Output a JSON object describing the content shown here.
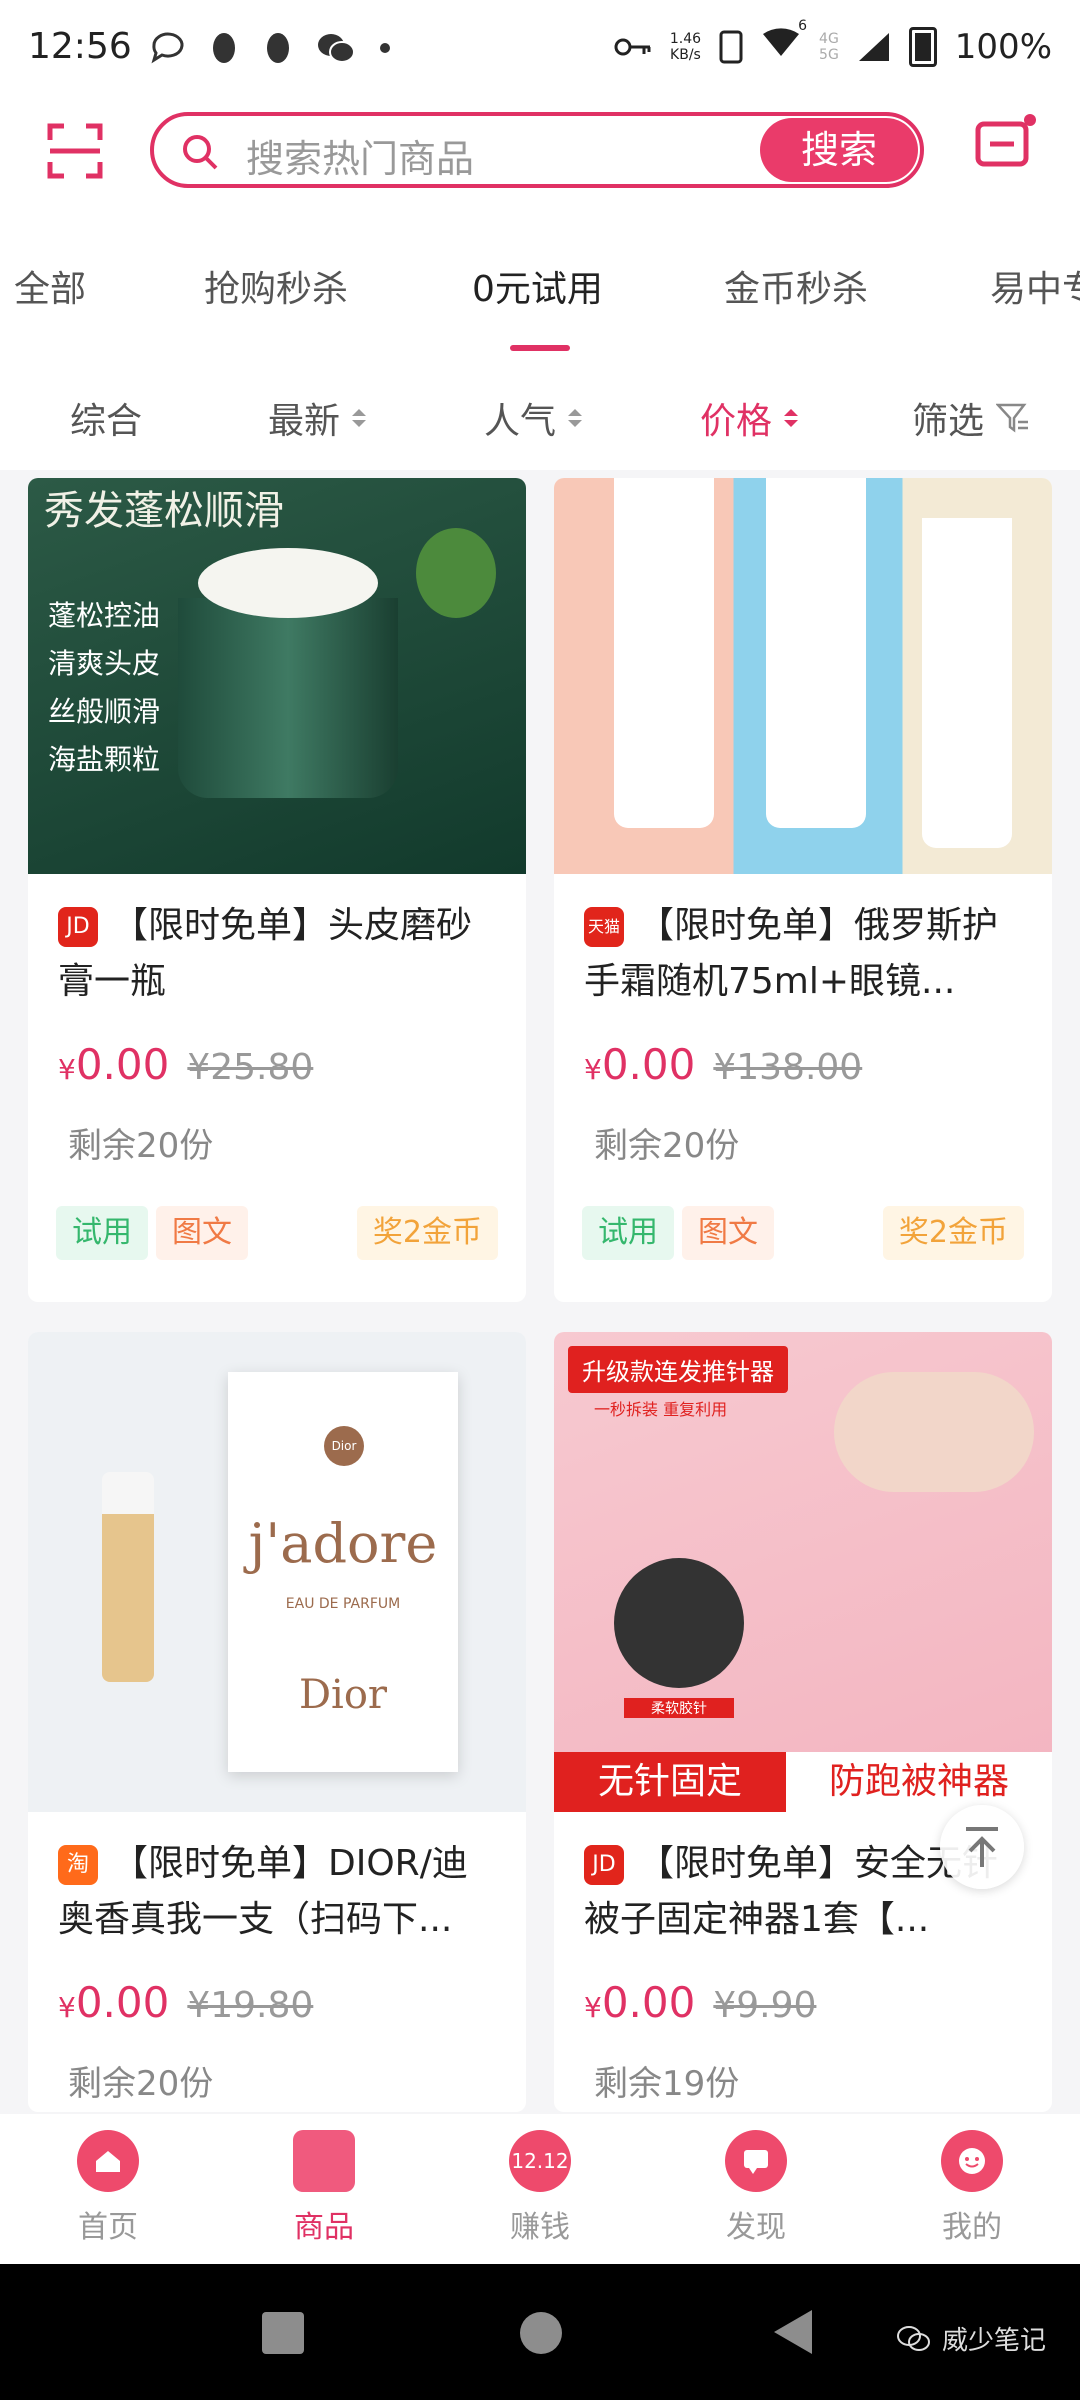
{
  "status": {
    "time": "12:56",
    "speed_top": "1.46",
    "speed_unit": "KB/s",
    "network_top": "4G",
    "network_bottom": "5G",
    "signal_badge": "6",
    "battery": "100%"
  },
  "header": {
    "search_placeholder": "搜索热门商品",
    "search_button": "搜索"
  },
  "tabs": [
    {
      "label": "全部"
    },
    {
      "label": "抢购秒杀"
    },
    {
      "label": "0元试用"
    },
    {
      "label": "金币秒杀"
    },
    {
      "label": "易中专"
    }
  ],
  "sort": [
    {
      "label": "综合"
    },
    {
      "label": "最新"
    },
    {
      "label": "人气"
    },
    {
      "label": "价格"
    },
    {
      "label": "筛选"
    }
  ],
  "products": [
    {
      "platform": "JD",
      "platform_color": "#e1251b",
      "title": "【限时免单】头皮磨砂膏一瓶",
      "price_symbol": "¥",
      "price": "0.00",
      "original": "¥25.80",
      "remaining": "剩余20份",
      "image_text": [
        "秀发蓬松顺滑",
        "蓬松控油",
        "清爽头皮",
        "丝般顺滑",
        "海盐颗粒"
      ],
      "tags": [
        "试用",
        "图文",
        "奖2金币"
      ]
    },
    {
      "platform": "天猫",
      "platform_color": "#e1251b",
      "title": "【限时免单】俄罗斯护手霜随机75ml+眼镜...",
      "price_symbol": "¥",
      "price": "0.00",
      "original": "¥138.00",
      "remaining": "剩余20份",
      "tags": [
        "试用",
        "图文",
        "奖2金币"
      ]
    },
    {
      "platform": "淘",
      "platform_color": "#ff6a1a",
      "title": "【限时免单】DIOR/迪奥香真我一支（扫码下...",
      "price_symbol": "¥",
      "price": "0.00",
      "original": "¥19.80",
      "remaining": "剩余20份",
      "image_text": [
        "Dior",
        "j'adore",
        "EAU DE PARFUM",
        "Dior"
      ]
    },
    {
      "platform": "JD",
      "platform_color": "#e1251b",
      "title": "【限时免单】安全无针被子固定神器1套【...",
      "price_symbol": "¥",
      "price": "0.00",
      "original": "¥9.90",
      "remaining": "剩余19份",
      "image_text": [
        "升级款连发推针器",
        "一秒拆装 重复利用",
        "柔软胶针",
        "无针固定",
        "防跑被神器"
      ]
    }
  ],
  "bottom_nav": [
    {
      "label": "首页"
    },
    {
      "label": "商品"
    },
    {
      "label": "赚钱",
      "icon_text": "12.12"
    },
    {
      "label": "发现"
    },
    {
      "label": "我的"
    }
  ],
  "watermark": "威少笔记",
  "colors": {
    "accent": "#e03164",
    "try_tag": "#35b76d",
    "pic_tag": "#f07a45",
    "coin_tag": "#f2a33a"
  }
}
